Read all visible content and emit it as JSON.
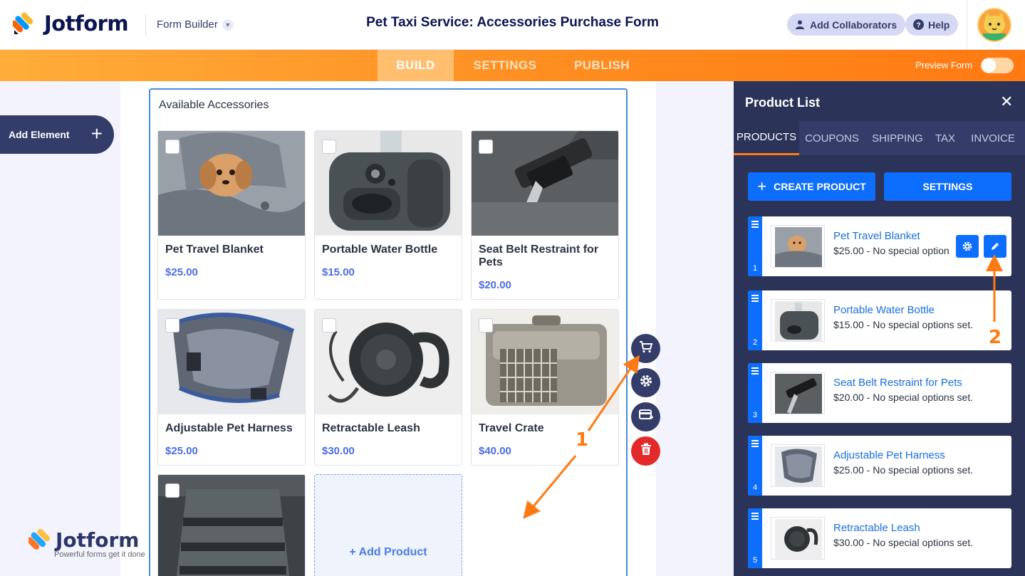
{
  "header": {
    "logo_text": "Jotform",
    "builder_label": "Form Builder",
    "form_title": "Pet Taxi Service: Accessories Purchase Form",
    "add_collaborators": "Add Collaborators",
    "help": "Help"
  },
  "nav": {
    "tabs": [
      {
        "label": "BUILD",
        "active": true
      },
      {
        "label": "SETTINGS",
        "active": false
      },
      {
        "label": "PUBLISH",
        "active": false
      }
    ],
    "preview_label": "Preview Form"
  },
  "left": {
    "add_element": "Add Element"
  },
  "form": {
    "field_label": "Available Accessories",
    "products": [
      {
        "name": "Pet Travel Blanket",
        "price": "$25.00",
        "icon": "blanket-image"
      },
      {
        "name": "Portable Water Bottle",
        "price": "$15.00",
        "icon": "water-bottle-image"
      },
      {
        "name": "Seat Belt Restraint for Pets",
        "price": "$20.00",
        "icon": "seat-belt-image"
      },
      {
        "name": "Adjustable Pet Harness",
        "price": "$25.00",
        "icon": "harness-image"
      },
      {
        "name": "Retractable Leash",
        "price": "$30.00",
        "icon": "leash-image"
      },
      {
        "name": "Travel Crate",
        "price": "$40.00",
        "icon": "crate-image"
      },
      {
        "name": "",
        "price": "",
        "icon": "seat-cover-image"
      }
    ],
    "add_product": "+ Add Product"
  },
  "watermark": {
    "text": "Jotform",
    "tagline": "Powerful forms get it done"
  },
  "panel": {
    "title": "Product List",
    "tabs": [
      {
        "label": "PRODUCTS",
        "active": true
      },
      {
        "label": "COUPONS",
        "active": false
      },
      {
        "label": "SHIPPING",
        "active": false
      },
      {
        "label": "TAX",
        "active": false
      },
      {
        "label": "INVOICE",
        "active": false
      }
    ],
    "create_product": "CREATE PRODUCT",
    "settings": "SETTINGS",
    "items": [
      {
        "num": "1",
        "name": "Pet Travel Blanket",
        "desc": "$25.00 - No special option"
      },
      {
        "num": "2",
        "name": "Portable Water Bottle",
        "desc": "$15.00 - No special options set."
      },
      {
        "num": "3",
        "name": "Seat Belt Restraint for Pets",
        "desc": "$20.00 - No special options set."
      },
      {
        "num": "4",
        "name": "Adjustable Pet Harness",
        "desc": "$25.00 - No special options set."
      },
      {
        "num": "5",
        "name": "Retractable Leash",
        "desc": "$30.00 - No special options set."
      }
    ]
  },
  "annotations": {
    "one": "1",
    "two": "2"
  },
  "colors": {
    "accent_orange": "#ff7a12",
    "primary_blue": "#0d6efd",
    "navy": "#343c6a"
  }
}
